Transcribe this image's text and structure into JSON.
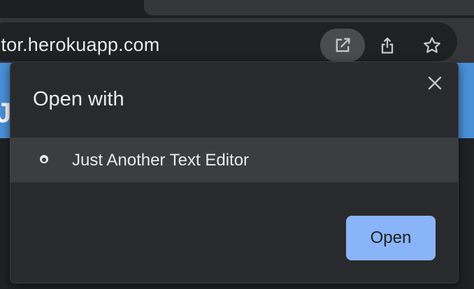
{
  "browser": {
    "url_text": "ditor.herokuapp.com",
    "actions": {
      "open_with": {
        "icon": "open-in-new-icon"
      },
      "share": {
        "icon": "share-icon"
      },
      "bookmark": {
        "icon": "star-icon"
      }
    }
  },
  "page": {
    "header_fragment": "J",
    "brand_color": "#4a90d9"
  },
  "dialog": {
    "title": "Open with",
    "apps": [
      {
        "name": "Just Another Text Editor",
        "icon": "app-icon"
      }
    ],
    "open_label": "Open",
    "accent": "#8ab4f8"
  }
}
